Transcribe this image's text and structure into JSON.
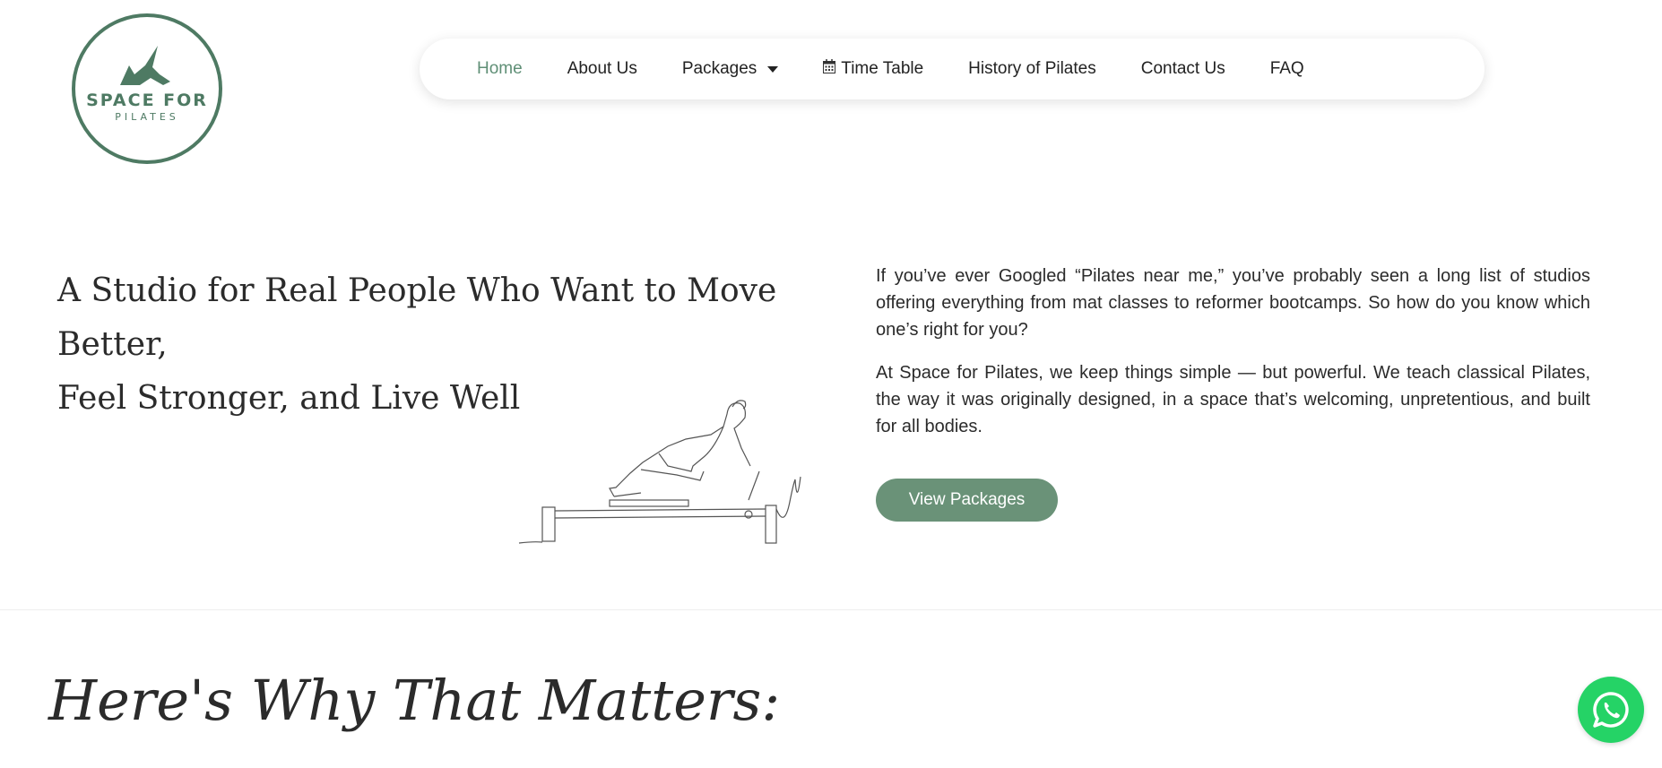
{
  "logo": {
    "line1": "SPACE FOR",
    "line2": "PILATES"
  },
  "nav": {
    "home": "Home",
    "about": "About Us",
    "packages": "Packages",
    "timetable": "Time Table",
    "history": "History of Pilates",
    "contact": "Contact Us",
    "faq": "FAQ",
    "active_color": "#5f8f76"
  },
  "hero": {
    "title_line1": "A Studio for Real People Who Want to Move Better,",
    "title_line2": "Feel Stronger, and Live Well",
    "paragraph1": "If you’ve ever Googled “Pilates near me,” you’ve probably seen a long list of studios offering everything from mat classes to reformer bootcamps. So how do you know which one’s right for you?",
    "paragraph2": "At Space for Pilates, we keep things simple — but powerful. We teach classical Pilates, the way it was originally designed, in a space that’s welcoming, unpretentious, and built for all bodies.",
    "button_label": "View Packages",
    "button_color": "#6a9278"
  },
  "section": {
    "title": "Here's Why That Matters:"
  },
  "icons": {
    "calendar": "calendar-icon",
    "whatsapp": "whatsapp-icon",
    "caret": "chevron-down-icon"
  }
}
